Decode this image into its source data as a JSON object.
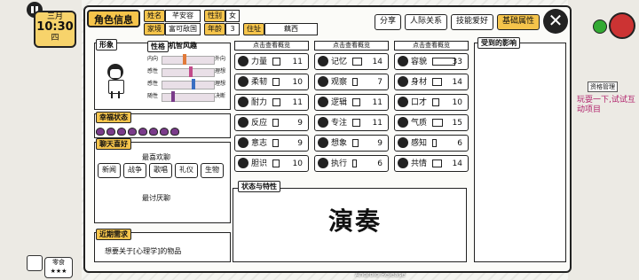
{
  "hud": {
    "month": "三月",
    "time": "10:30",
    "weekday": "四",
    "snack_label": "零食",
    "side_text": "玩耍一下,试试互动项目",
    "side_badge": "资格管理",
    "version": "Android Release"
  },
  "tabs": {
    "role_info": "角色信息",
    "share": "分享",
    "relations": "人际关系",
    "skills": "技能爱好",
    "basic_attrs": "基础属性"
  },
  "profile": {
    "name_label": "姓名",
    "name": "芊安容",
    "gender_label": "性别",
    "gender": "女",
    "family_label": "家境",
    "family": "富可敌国",
    "age_label": "年龄",
    "age": "3",
    "residence_label": "住址",
    "residence": "藕西"
  },
  "left": {
    "appearance_label": "形象",
    "personality_label": "性格",
    "personality_value": "机智风趣",
    "traits": [
      {
        "left": "内向",
        "right": "外向",
        "level": 0.42,
        "color": "#e07a3a"
      },
      {
        "left": "感性",
        "right": "理想",
        "level": 0.55,
        "color": "#c24a8a"
      },
      {
        "left": "感性",
        "right": "理想",
        "level": 0.6,
        "color": "#3a6fc2"
      },
      {
        "left": "随性",
        "right": "决断",
        "level": 0.2,
        "color": "#7a3b8a"
      }
    ],
    "happiness_label": "幸福状态",
    "hearts": 8,
    "chat_label": "聊天喜好",
    "favorite_label": "最喜欢聊",
    "topics": [
      "新闻",
      "战争",
      "歌唱",
      "礼仪",
      "生物"
    ],
    "dislike_label": "最讨厌聊",
    "needs_label": "近期需求",
    "needs_text": "想要关于[心理学]的物品"
  },
  "attributes": {
    "view_label": "点击查看概览",
    "columns": [
      [
        {
          "name": "力量",
          "value": 11
        },
        {
          "name": "柔韧",
          "value": 10
        },
        {
          "name": "耐力",
          "value": 11
        },
        {
          "name": "反应",
          "value": 9
        },
        {
          "name": "意志",
          "value": 9
        },
        {
          "name": "胆识",
          "value": 10
        }
      ],
      [
        {
          "name": "记忆",
          "value": 14
        },
        {
          "name": "观察",
          "value": 7
        },
        {
          "name": "逻辑",
          "value": 11
        },
        {
          "name": "专注",
          "value": 11
        },
        {
          "name": "想象",
          "value": 9
        },
        {
          "name": "执行",
          "value": 6
        }
      ],
      [
        {
          "name": "容貌",
          "value": 33
        },
        {
          "name": "身材",
          "value": 14
        },
        {
          "name": "口才",
          "value": 10
        },
        {
          "name": "气质",
          "value": 15
        },
        {
          "name": "感知",
          "value": 6
        },
        {
          "name": "共情",
          "value": 14
        }
      ]
    ],
    "max": 35
  },
  "influence": {
    "label": "受到的影响"
  },
  "status": {
    "label": "状态与特性",
    "value": "演奏"
  }
}
